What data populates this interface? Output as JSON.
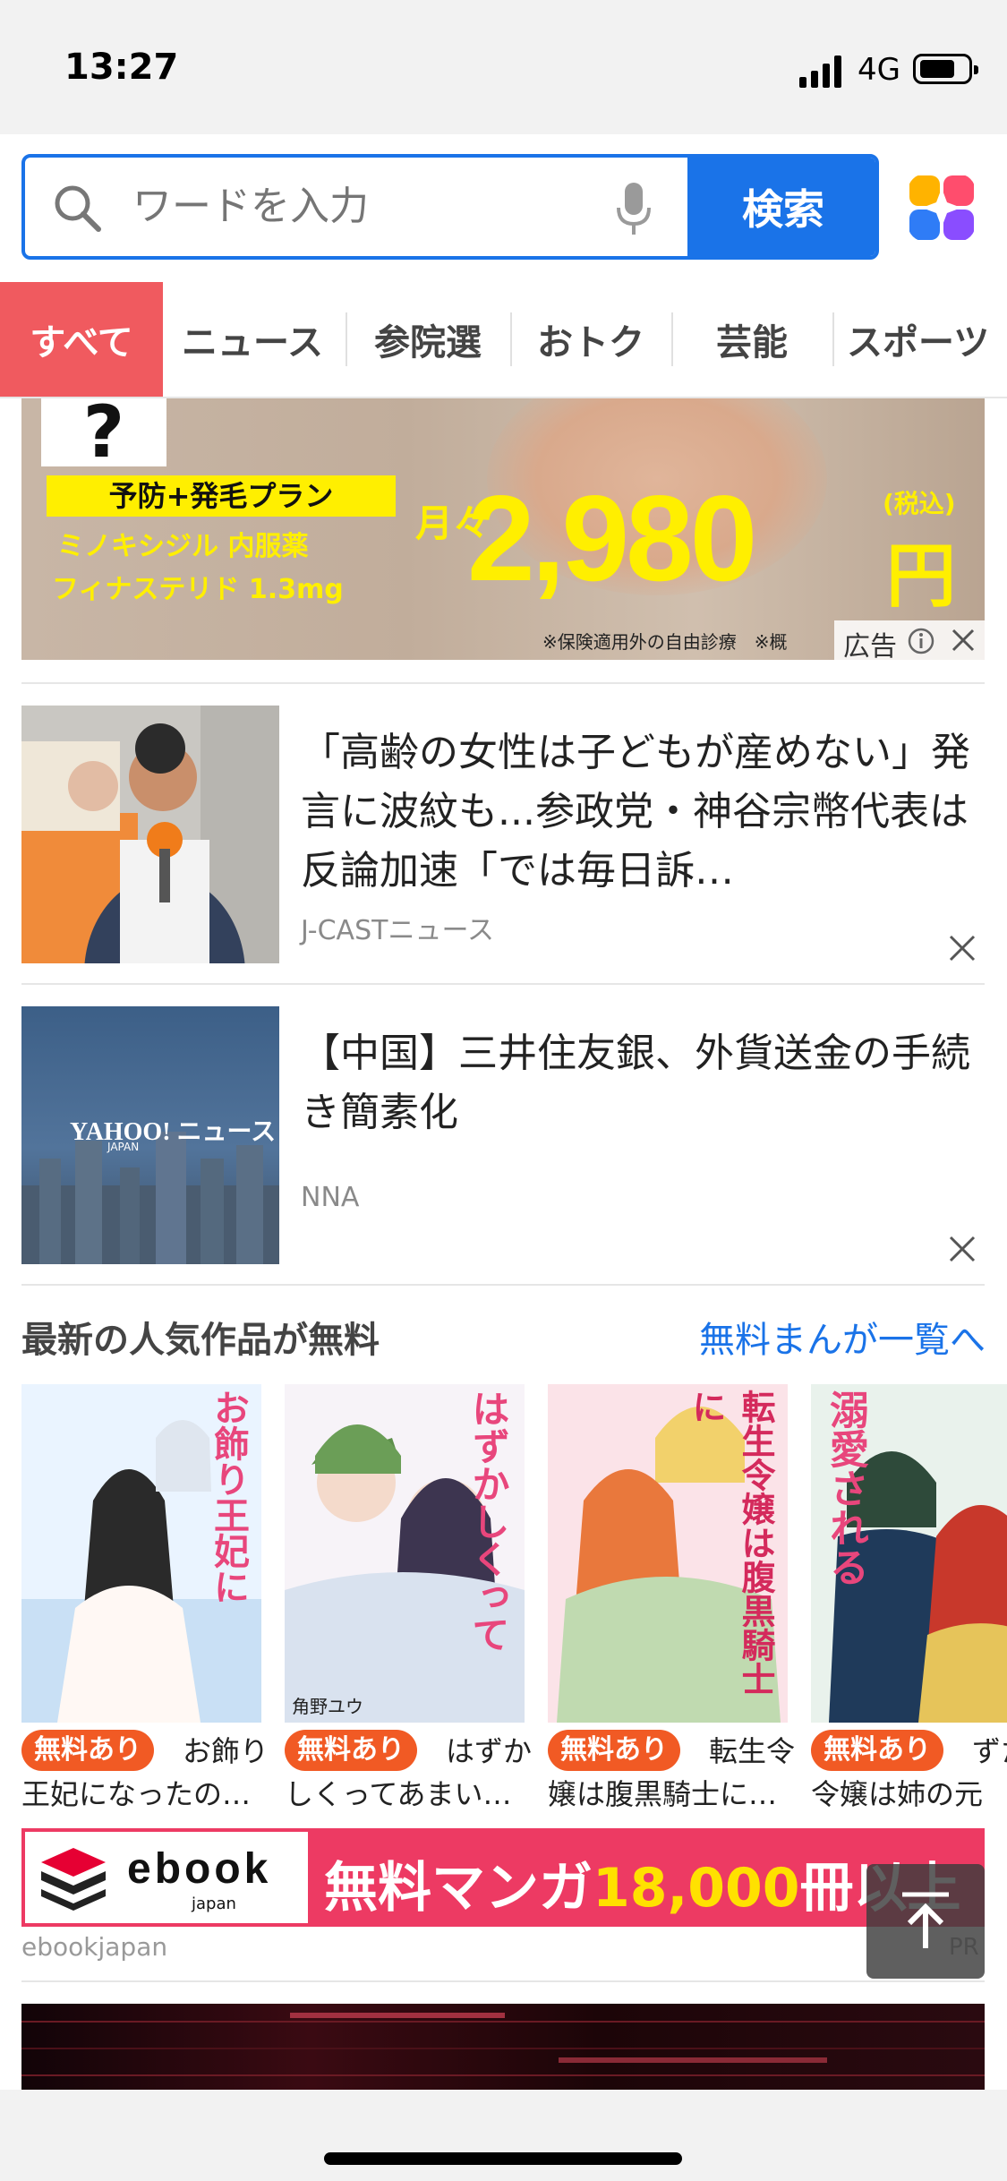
{
  "status_bar": {
    "time": "13:27",
    "network": "4G"
  },
  "search": {
    "placeholder": "ワードを入力",
    "button_label": "検索"
  },
  "tabs": [
    "すべて",
    "ニュース",
    "参院選",
    "おトク",
    "芸能",
    "スポーツ"
  ],
  "active_tab": 0,
  "ad_banner": {
    "question": "?",
    "plan": "予防+発毛プラン",
    "line1": "ミノキシジル 内服薬",
    "line2": "フィナステリド 1.3mg",
    "monthly": "月々",
    "price": "2,980",
    "tax": "(税込)",
    "yen": "円",
    "note": "※保険適用外の自由診療　※概",
    "ad_label": "広告"
  },
  "news": [
    {
      "title": "「高齢の女性は子どもが産めない」発言に波紋も...参政党・神谷宗幣代表は反論加速「では毎日訴…",
      "source": "J-CASTニュース"
    },
    {
      "title": "【中国】三井住友銀、外貨送金の手続き簡素化",
      "source": "NNA",
      "thumb_logo": "YAHOO! ニュース",
      "thumb_sub": "JAPAN"
    }
  ],
  "manga_section": {
    "title": "最新の人気作品が無料",
    "link": "無料まんが一覧へ",
    "items": [
      {
        "badge": "無料あり",
        "title": "お飾り王妃になったの…",
        "cover_text": "お飾り王妃に"
      },
      {
        "badge": "無料あり",
        "title": "はずかしくってあまい…",
        "cover_text": "はずかしくって",
        "cover_author": "角野ユウ"
      },
      {
        "badge": "無料あり",
        "title": "転生令嬢は腹黒騎士に…",
        "cover_text": "転生令嬢は腹黒騎士に"
      },
      {
        "badge": "無料あり",
        "title": "ずたろ令嬢は姉の元",
        "cover_text": "溺愛される"
      }
    ]
  },
  "ebook_banner": {
    "logo": "ebook",
    "logo_sub": "japan",
    "text_a": "無料マンガ",
    "text_num": "18,000",
    "text_b": "冊以上",
    "label": "ebookjapan",
    "pr": "PR"
  },
  "colors": {
    "accent_blue": "#1a73e8",
    "active_tab": "#f05a5f",
    "badge_orange": "#f15a24",
    "ad_yellow": "#ffef00",
    "ebook_pink": "#ed3a63"
  }
}
